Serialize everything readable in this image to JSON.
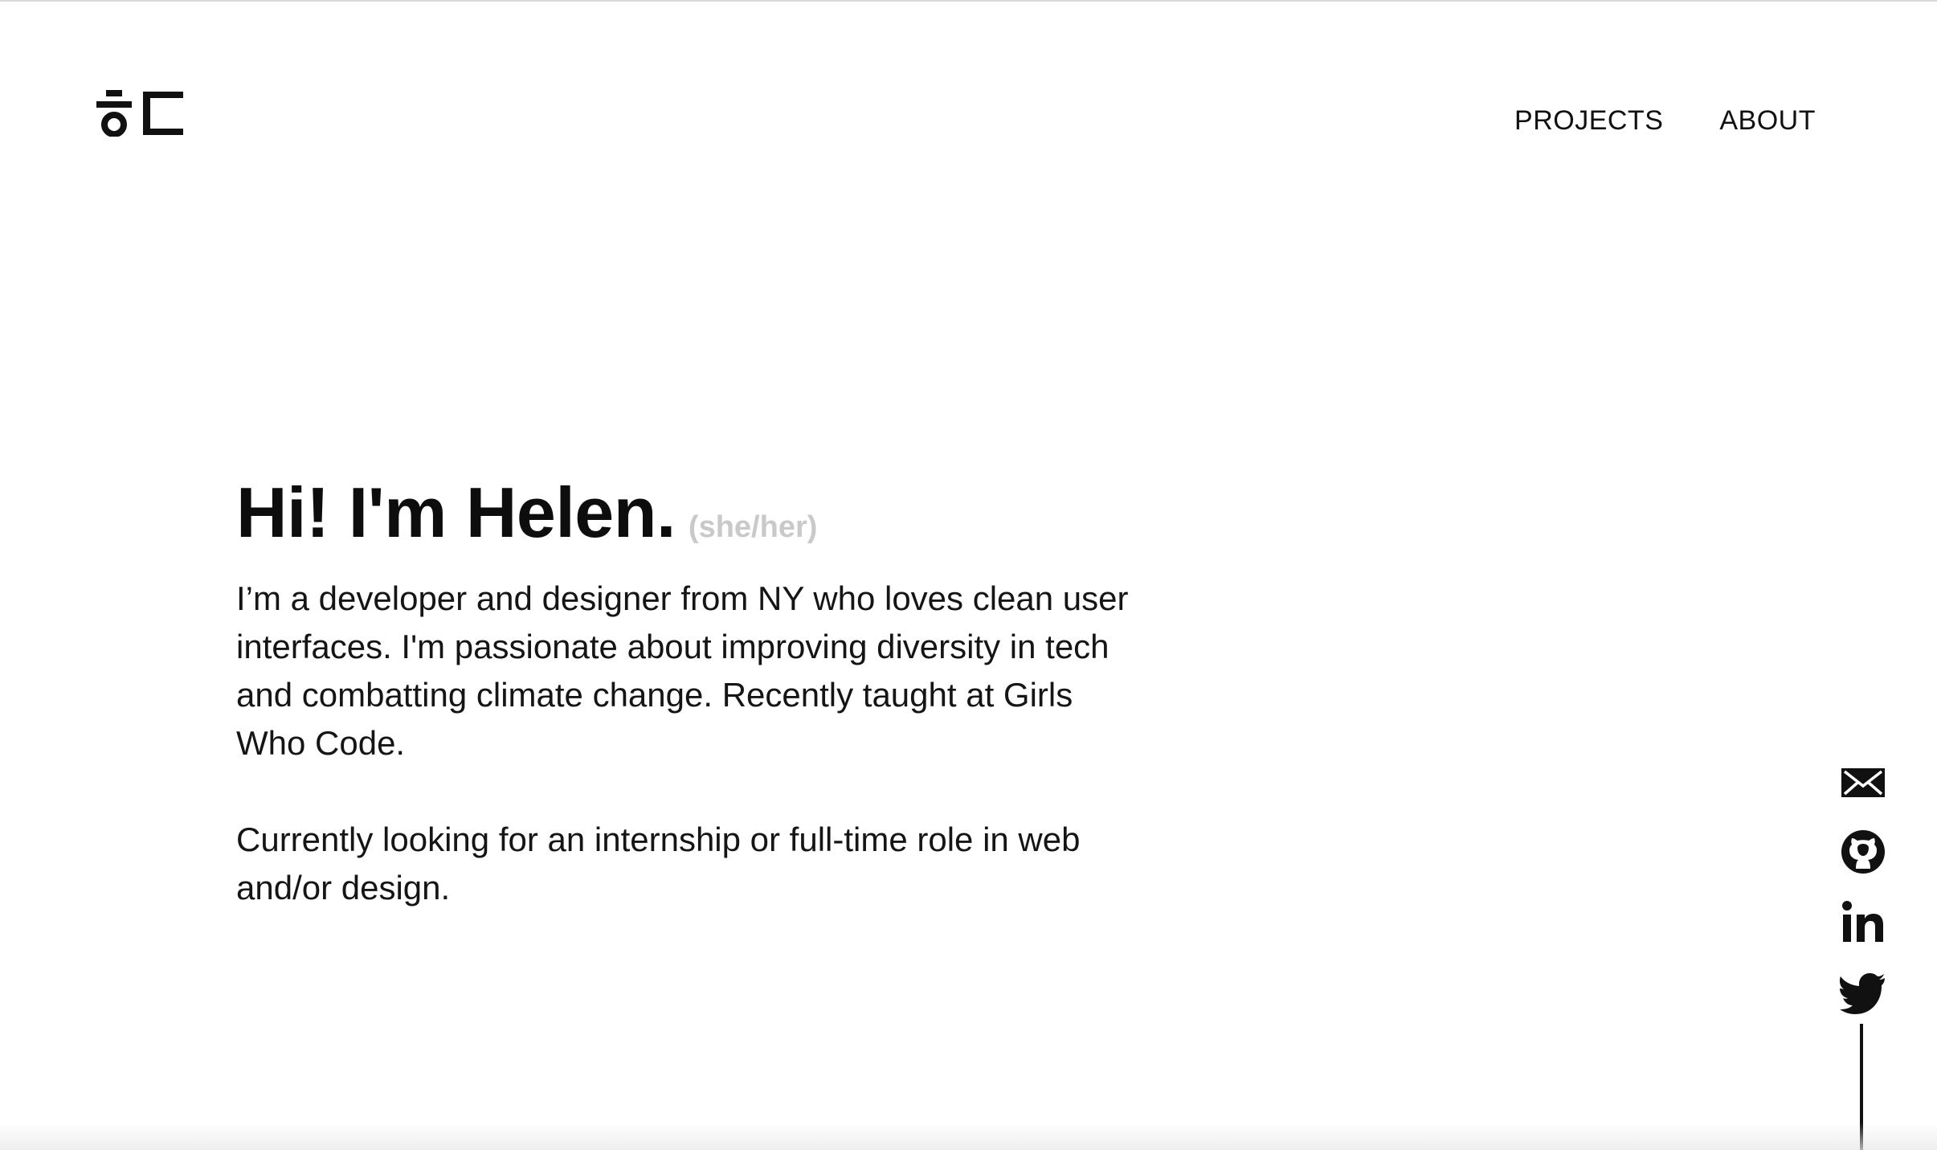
{
  "nav": {
    "items": [
      {
        "label": "PROJECTS"
      },
      {
        "label": "ABOUT"
      }
    ]
  },
  "logo": {
    "icon": "hangul-monogram-logo",
    "text": "ㅎㄷ"
  },
  "hero": {
    "title": "Hi! I'm Helen.",
    "pronouns": "(she/her)",
    "paragraphs": [
      "I’m a developer and designer from NY who loves clean user interfaces. I'm passionate about improving diversity in tech and combatting climate change. Recently taught at Girls Who Code.",
      "Currently looking for an internship or full-time role in web and/or design."
    ]
  },
  "social": {
    "items": [
      {
        "icon": "mail-icon"
      },
      {
        "icon": "github-icon"
      },
      {
        "icon": "linkedin-icon"
      },
      {
        "icon": "twitter-icon"
      }
    ]
  },
  "colors": {
    "text": "#111111",
    "pronouns": "#c9c9c9",
    "background": "#ffffff"
  }
}
